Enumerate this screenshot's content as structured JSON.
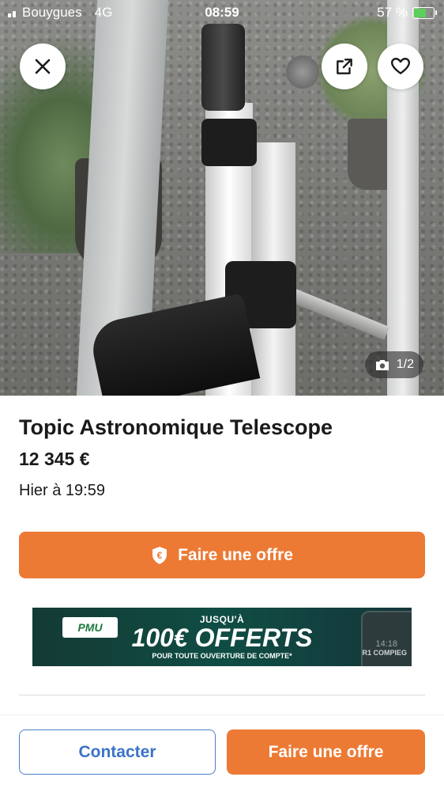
{
  "status_bar": {
    "carrier": "Bouygues",
    "network": "4G",
    "time": "08:59",
    "battery_percent": "57 %",
    "battery_level": 0.57
  },
  "photo": {
    "counter": "1/2",
    "icons": {
      "close": "close-icon",
      "share": "external-link-icon",
      "favorite": "heart-icon",
      "camera": "camera-icon"
    }
  },
  "listing": {
    "title": "Topic Astronomique Telescope",
    "price": "12 345 €",
    "date": "Hier à 19:59"
  },
  "offer_button": {
    "label": "Faire une offre",
    "icon": "euro-shield-icon"
  },
  "ad": {
    "logo": "PMU",
    "top_text": "JUSQU'À",
    "main_text": "100€ OFFERTS",
    "sub_text": "POUR TOUTE OUVERTURE DE COMPTE*",
    "phone_time": "14:18",
    "phone_text": "R1 COMPIEG"
  },
  "bottom_bar": {
    "contact_label": "Contacter",
    "offer_label": "Faire une offre"
  },
  "colors": {
    "accent": "#ec7a34",
    "link": "#3b73c7"
  }
}
